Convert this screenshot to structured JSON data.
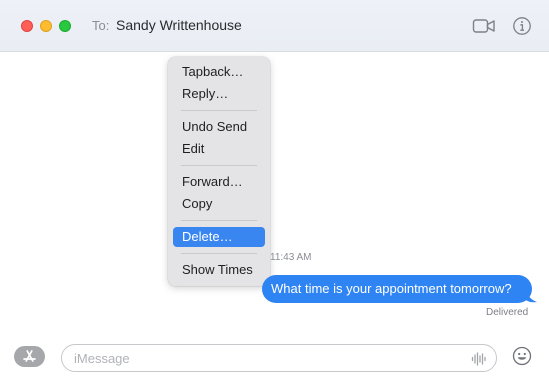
{
  "window": {
    "recipient_prefix": "To:",
    "recipient_name": "Sandy Writtenhouse"
  },
  "context_menu": {
    "items": [
      {
        "label": "Tapback…"
      },
      {
        "label": "Reply…"
      },
      {
        "label": "Undo Send"
      },
      {
        "label": "Edit"
      },
      {
        "label": "Forward…"
      },
      {
        "label": "Copy"
      },
      {
        "label": "Delete…",
        "highlighted": true
      },
      {
        "label": "Show Times"
      }
    ]
  },
  "conversation": {
    "timestamp": "11:43 AM",
    "message": "What time is your appointment tomorrow?",
    "status": "Delivered"
  },
  "composer": {
    "placeholder": "iMessage"
  },
  "icons": {
    "video": "video-camera-icon",
    "info": "info-icon",
    "apps": "app-store-icon",
    "audio": "audio-waveform-icon",
    "emoji": "emoji-icon"
  },
  "colors": {
    "accent": "#2f84f4",
    "menu_highlight": "#3a86f0",
    "close": "#ff5f57",
    "minimize": "#febc2e",
    "zoom": "#28c840"
  }
}
